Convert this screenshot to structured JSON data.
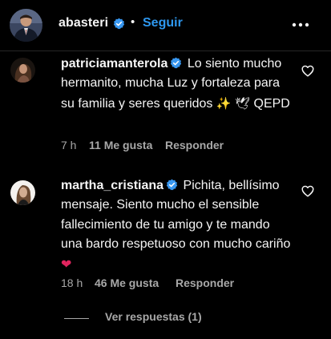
{
  "header": {
    "username": "abasteri",
    "separator": "•",
    "follow_label": "Seguir",
    "avatar_icon": "profile-avatar",
    "more_icon": "more-horizontal-icon"
  },
  "comments": [
    {
      "username": "patriciamanterola",
      "verified": true,
      "text_part1": "Lo siento mucho hermanito, mucha Luz y fortaleza para su familia y seres queridos",
      "emoji_sparkles": "✨",
      "emoji_dove": "🕊",
      "text_part2": "QEPD",
      "time": "7 h",
      "likes": "11 Me gusta",
      "reply_label": "Responder"
    },
    {
      "username": "martha_cristiana",
      "verified": true,
      "text_part1": "Pichita, bellísimo mensaje. Siento mucho el sensible fallecimiento de tu amigo y te mando una bardo respetuoso con mucho cariño",
      "emoji_heart": "❤",
      "time": "18 h",
      "likes": "46 Me gusta",
      "reply_label": "Responder"
    }
  ],
  "view_replies_label": "Ver respuestas (1)",
  "colors": {
    "background": "#000000",
    "text": "#f5f5f5",
    "muted": "#a8a8a8",
    "link": "#2e98f0",
    "verified": "#3897f0"
  }
}
